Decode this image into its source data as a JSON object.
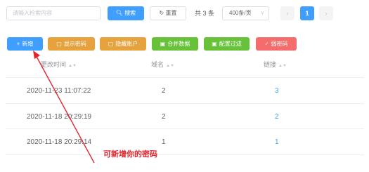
{
  "search": {
    "placeholder": "请输入检索内容"
  },
  "buttons": {
    "search": "搜索",
    "reset": "重置"
  },
  "pagination": {
    "total": "共 3 条",
    "page_size": "400条/页",
    "current": "1"
  },
  "toolbar": {
    "add": "新增",
    "show_password": "显示密码",
    "hide_account": "隐藏账户",
    "merge_data": "合并数据",
    "config_filter": "配置过滤",
    "weak_password": "弱密码"
  },
  "table": {
    "headers": {
      "time": "更改时间",
      "domain": "域名",
      "link": "链接"
    },
    "rows": [
      {
        "time": "2020-11-23 11:07:22",
        "domain": "2",
        "link": "3"
      },
      {
        "time": "2020-11-18 20:29:19",
        "domain": "2",
        "link": "2"
      },
      {
        "time": "2020-11-18 20:29:14",
        "domain": "1",
        "link": "1"
      }
    ]
  },
  "annotation": {
    "text": "可新增你的密码",
    "color": "#e3262d"
  },
  "colors": {
    "primary": "#409eff",
    "warning": "#e6a23c",
    "success": "#67c23a",
    "danger": "#f56c6c"
  }
}
